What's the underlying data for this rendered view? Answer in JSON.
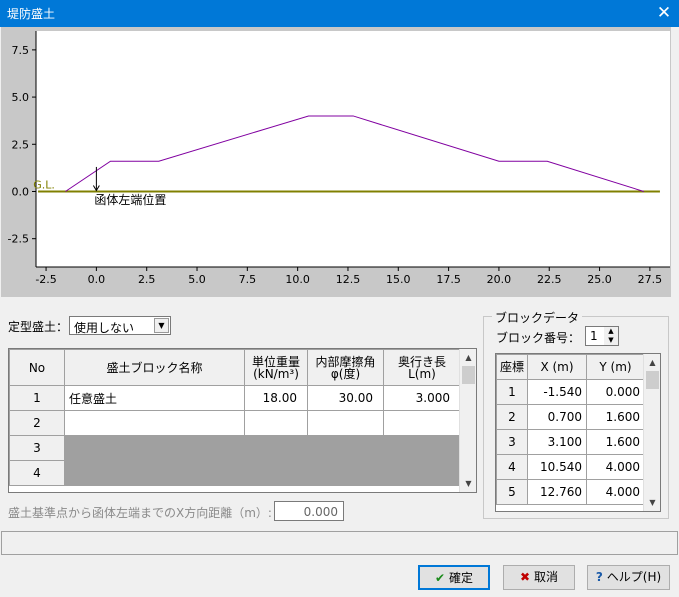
{
  "window": {
    "title": "堤防盛土",
    "close_glyph": "✕"
  },
  "chart_data": {
    "type": "line",
    "xlim": [
      -3,
      28.5
    ],
    "ylim": [
      -4,
      8.5
    ],
    "x_ticks": [
      -2.5,
      0.0,
      2.5,
      5.0,
      7.5,
      10.0,
      12.5,
      15.0,
      17.5,
      20.0,
      22.5,
      25.0,
      27.5
    ],
    "x_tick_labels": [
      "-2.5",
      "0.0",
      "2.5",
      "5.0",
      "7.5",
      "10.0",
      "12.5",
      "15.0",
      "17.5",
      "20.0",
      "22.5",
      "25.0",
      "27.5"
    ],
    "y_ticks": [
      7.5,
      5.0,
      2.5,
      0.0,
      -2.5
    ],
    "y_tick_labels": [
      "7.5",
      "5.0",
      "2.5",
      "0.0",
      "-2.5"
    ],
    "series": [
      {
        "type": "polyline",
        "color": "#8000a0",
        "x": [
          -1.54,
          0.7,
          3.1,
          10.54,
          12.76,
          20.0,
          22.4,
          27.2
        ],
        "y": [
          0.0,
          1.6,
          1.6,
          4.0,
          4.0,
          1.6,
          1.6,
          0.0
        ]
      },
      {
        "type": "ground",
        "color": "#808000",
        "x": [
          -2.5,
          28.0
        ],
        "y": [
          0,
          0
        ]
      }
    ],
    "gl_label": "G.L.",
    "annotation": {
      "text": "函体左端位置",
      "x": 0.0
    },
    "background": "#ffffff",
    "frame_background": "#c8c8c8"
  },
  "form": {
    "teikei_label": "定型盛土：",
    "teikei_value": "使用しない",
    "distance_label": "盛土基準点から函体左端までのX方向距離（m）:",
    "distance_value": "0.000"
  },
  "block_table": {
    "headers": {
      "no": "No",
      "name": "盛土ブロック名称",
      "unit_weight_1": "単位重量",
      "unit_weight_2": "(kN/m³)",
      "friction_1": "内部摩擦角",
      "friction_2": "φ(度)",
      "depth_1": "奥行き長",
      "depth_2": "L(m)"
    },
    "rows": [
      {
        "no": "1",
        "name": "任意盛土",
        "weight": "18.00",
        "friction": "30.00",
        "depth": "3.000"
      },
      {
        "no": "2",
        "name": "",
        "weight": "",
        "friction": "",
        "depth": ""
      },
      {
        "no": "3",
        "name": "",
        "weight": "",
        "friction": "",
        "depth": ""
      },
      {
        "no": "4",
        "name": "",
        "weight": "",
        "friction": "",
        "depth": ""
      }
    ]
  },
  "block_data": {
    "group_title": "ブロックデータ",
    "block_no_label": "ブロック番号：",
    "block_no_value": "1",
    "headers": {
      "coord": "座標",
      "x": "X (m)",
      "y": "Y (m)"
    },
    "rows": [
      {
        "no": "1",
        "x": "-1.540",
        "y": "0.000"
      },
      {
        "no": "2",
        "x": "0.700",
        "y": "1.600"
      },
      {
        "no": "3",
        "x": "3.100",
        "y": "1.600"
      },
      {
        "no": "4",
        "x": "10.540",
        "y": "4.000"
      },
      {
        "no": "5",
        "x": "12.760",
        "y": "4.000"
      }
    ]
  },
  "buttons": {
    "ok_label": "確定",
    "ok_icon": "check-icon",
    "cancel_label": "取消",
    "cancel_icon": "x-icon",
    "help_label": "ヘルプ(H)",
    "help_icon": "question-icon"
  }
}
